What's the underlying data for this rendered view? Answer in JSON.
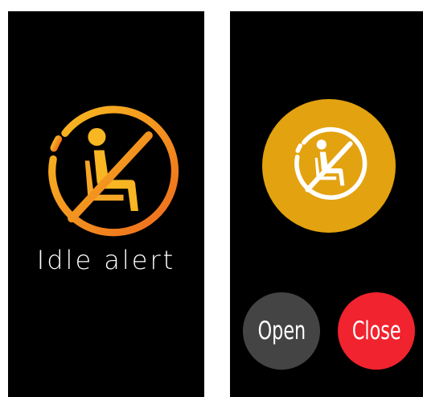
{
  "left_screen": {
    "icon": "no-sitting-icon",
    "title": "Idle alert"
  },
  "right_screen": {
    "icon": "no-sitting-icon",
    "buttons": {
      "open_label": "Open",
      "close_label": "Close"
    }
  },
  "colors": {
    "background": "#000000",
    "accent_orange": "#e3a20f",
    "gradient_start": "#f5b623",
    "gradient_end": "#ef6f1e",
    "open_button": "#444444",
    "close_button": "#f0232e",
    "text": "#ffffff"
  }
}
